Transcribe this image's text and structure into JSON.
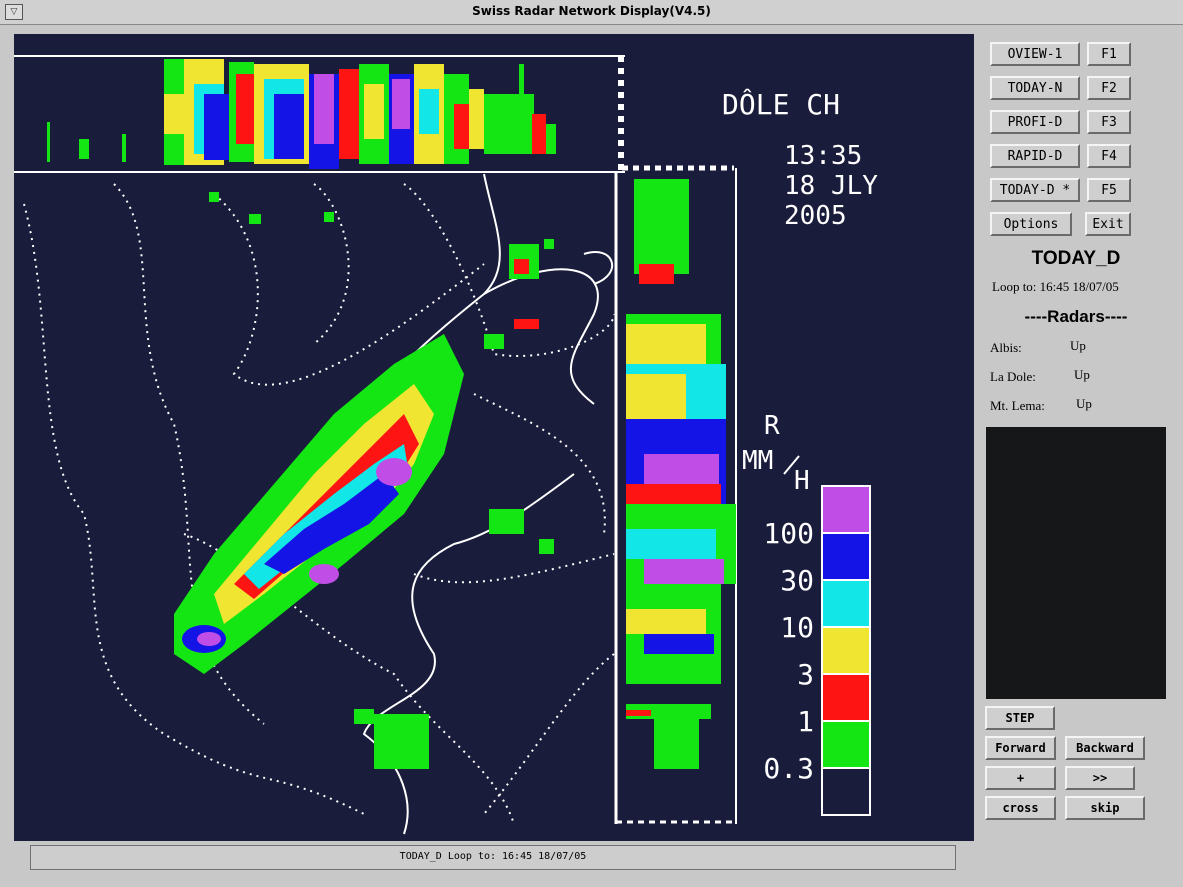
{
  "window": {
    "title": "Swiss Radar Network Display(V4.5)"
  },
  "display": {
    "station": "DÔLE CH",
    "time": "13:35",
    "date_line1": "18 JLY",
    "date_line2": "2005",
    "legend": {
      "unit_r": "R",
      "unit_mm": "MM",
      "unit_h": "H",
      "levels": [
        "100",
        "30",
        "10",
        "3",
        "1",
        "0.3"
      ],
      "colors": [
        "#c04ee6",
        "#1414e6",
        "#12e6e6",
        "#f0e632",
        "#ff1414",
        "#14e614",
        "#1a1c3b"
      ]
    }
  },
  "buttons": {
    "oview1": "OVIEW-1",
    "f1": "F1",
    "todayn": "TODAY-N",
    "f2": "F2",
    "profid": "PROFI-D",
    "f3": "F3",
    "rapidd": "RAPID-D",
    "f4": "F4",
    "todayd": "TODAY-D *",
    "f5": "F5",
    "options": "Options",
    "exit": "Exit",
    "step": "STEP",
    "forward": "Forward",
    "backward": "Backward",
    "plus": "+",
    "ff": ">>",
    "cross": "cross",
    "skip": "skip"
  },
  "panel": {
    "product": "TODAY_D",
    "loop_to": "Loop to: 16:45  18/07/05",
    "radars_heading": "----Radars----",
    "radars": [
      {
        "name": "Albis:",
        "status": "Up"
      },
      {
        "name": "La Dole:",
        "status": "Up"
      },
      {
        "name": "Mt. Lema:",
        "status": "Up"
      }
    ]
  },
  "statusbar": {
    "text": "TODAY_D Loop to: 16:45  18/07/05"
  }
}
